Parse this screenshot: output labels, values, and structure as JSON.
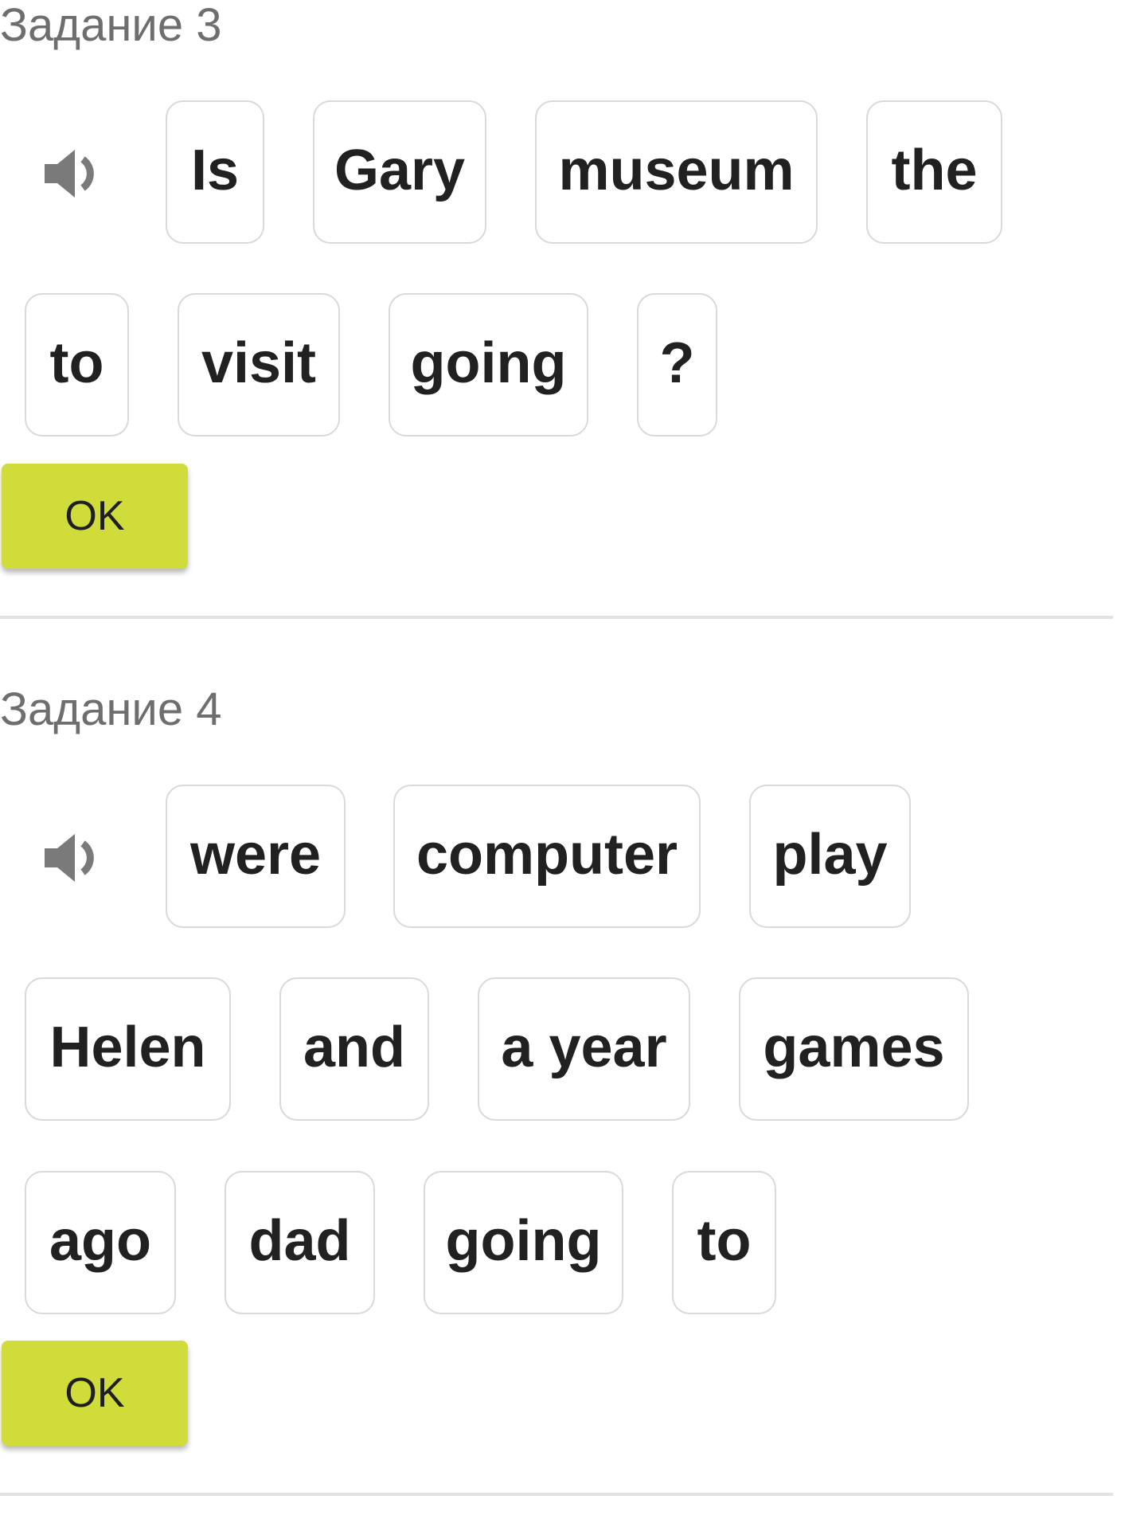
{
  "tasks": [
    {
      "title": "Задание 3",
      "speaker_icon": "speaker-volume-icon",
      "words": [
        "Is",
        "Gary",
        "museum",
        "the",
        "to",
        "visit",
        "going",
        "?"
      ],
      "ok_label": "OK"
    },
    {
      "title": "Задание 4",
      "speaker_icon": "speaker-volume-icon",
      "words": [
        "were",
        "computer",
        "play",
        "Helen",
        "and",
        "a year",
        "games",
        "ago",
        "dad",
        "going",
        "to"
      ],
      "ok_label": "OK"
    }
  ],
  "colors": {
    "ok_button": "#cfdc3a",
    "title_text": "#6e6e6e",
    "word_text": "#212121",
    "tile_border": "#d9d9d9",
    "speaker": "#7a7a7a",
    "divider": "#e2e2e2"
  }
}
